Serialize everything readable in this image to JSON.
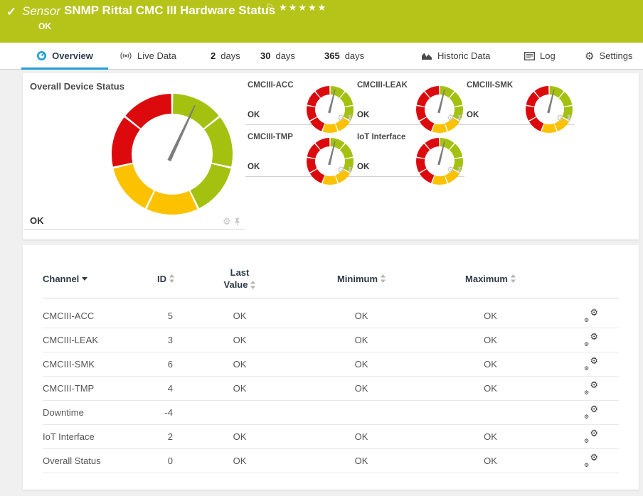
{
  "colors": {
    "header_green": "#b6c41a",
    "accent_blue": "#1e9ed9",
    "gauge_green": "#a3c10e",
    "gauge_yellow": "#fcc200",
    "gauge_red": "#dc0a0d"
  },
  "icons": {
    "gear": "⚙",
    "check": "✓",
    "flag": "⚐",
    "stars": "★★★★★"
  },
  "header": {
    "kind": "Sensor",
    "title": "SNMP Rittal CMC III Hardware Status",
    "status": "OK"
  },
  "tabs": {
    "overview": "Overview",
    "live_data": "Live Data",
    "d2_num": "2",
    "d2_label": "days",
    "d30_num": "30",
    "d30_label": "days",
    "d365_num": "365",
    "d365_label": "days",
    "historic": "Historic Data",
    "log": "Log",
    "settings": "Settings"
  },
  "overview": {
    "big": {
      "title": "Overall Device Status",
      "status": "OK"
    },
    "mini": [
      {
        "title": "CMCIII-ACC",
        "status": "OK"
      },
      {
        "title": "CMCIII-LEAK",
        "status": "OK"
      },
      {
        "title": "CMCIII-SMK",
        "status": "OK"
      },
      {
        "title": "CMCIII-TMP",
        "status": "OK"
      },
      {
        "title": "IoT Interface",
        "status": "OK"
      }
    ]
  },
  "gauges": {
    "palette": {
      "g": "#a3c10e",
      "y": "#fcc200",
      "r": "#dc0a0d"
    },
    "big": {
      "needle_deg": 25,
      "segments": [
        {
          "from": 1.0,
          "to": 50.4,
          "c": "g"
        },
        {
          "from": 52.4,
          "to": 101.9,
          "c": "g"
        },
        {
          "from": 103.9,
          "to": 153.3,
          "c": "g"
        },
        {
          "from": 155.3,
          "to": 204.7,
          "c": "y"
        },
        {
          "from": 206.7,
          "to": 256.1,
          "c": "y"
        },
        {
          "from": 258.1,
          "to": 307.6,
          "c": "r"
        },
        {
          "from": 309.6,
          "to": 359.0,
          "c": "r"
        }
      ]
    },
    "mini": {
      "needle_deg": 14,
      "segments": [
        {
          "from": 1.5,
          "to": 38.5,
          "c": "g"
        },
        {
          "from": 41.5,
          "to": 78.5,
          "c": "g"
        },
        {
          "from": 81.5,
          "to": 118.5,
          "c": "g"
        },
        {
          "from": 121.5,
          "to": 158.5,
          "c": "y"
        },
        {
          "from": 161.5,
          "to": 198.5,
          "c": "y"
        },
        {
          "from": 201.5,
          "to": 238.5,
          "c": "r"
        },
        {
          "from": 241.5,
          "to": 278.5,
          "c": "r"
        },
        {
          "from": 281.5,
          "to": 318.5,
          "c": "r"
        },
        {
          "from": 321.5,
          "to": 358.5,
          "c": "r"
        }
      ]
    }
  },
  "table": {
    "headers": {
      "channel": "Channel",
      "id": "ID",
      "last1": "Last",
      "last2": "Value",
      "min": "Minimum",
      "max": "Maximum"
    },
    "rows": [
      {
        "channel": "CMCIII-ACC",
        "id": "5",
        "last": "OK",
        "min": "OK",
        "max": "OK"
      },
      {
        "channel": "CMCIII-LEAK",
        "id": "3",
        "last": "OK",
        "min": "OK",
        "max": "OK"
      },
      {
        "channel": "CMCIII-SMK",
        "id": "6",
        "last": "OK",
        "min": "OK",
        "max": "OK"
      },
      {
        "channel": "CMCIII-TMP",
        "id": "4",
        "last": "OK",
        "min": "OK",
        "max": "OK"
      },
      {
        "channel": "Downtime",
        "id": "-4",
        "last": "",
        "min": "",
        "max": ""
      },
      {
        "channel": "IoT Interface",
        "id": "2",
        "last": "OK",
        "min": "OK",
        "max": "OK"
      },
      {
        "channel": "Overall Status",
        "id": "0",
        "last": "OK",
        "min": "OK",
        "max": "OK"
      }
    ]
  }
}
